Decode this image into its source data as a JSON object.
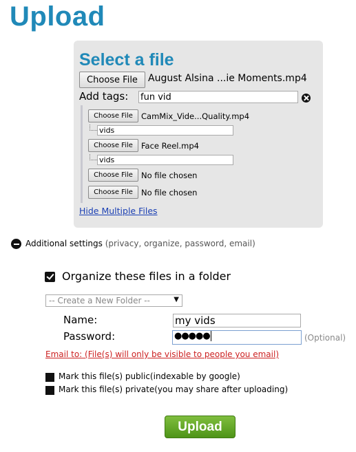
{
  "page": {
    "title": "Upload"
  },
  "select_file": {
    "heading": "Select a file",
    "choose_label": "Choose File",
    "chosen_file": "August Alsina ...ie Moments.mp4",
    "tags_label": "Add tags:",
    "tags_value": "fun vid"
  },
  "multiple_files": {
    "items": [
      {
        "choose_label": "Choose File",
        "file": "CamMix_Vide...Quality.mp4",
        "tags": "vids"
      },
      {
        "choose_label": "Choose File",
        "file": "Face Reel.mp4",
        "tags": "vids"
      },
      {
        "choose_label": "Choose File",
        "file": "No file chosen"
      },
      {
        "choose_label": "Choose File",
        "file": "No file chosen"
      }
    ],
    "hide_link": "Hide Multiple Files"
  },
  "additional": {
    "label": "Additional settings",
    "hint": "(privacy, organize, password, email)"
  },
  "folder": {
    "organize_label": "Organize these files in a folder",
    "organize_checked": true,
    "select_value": "-- Create a New Folder --",
    "name_label": "Name:",
    "name_value": "my vids",
    "password_label": "Password:",
    "password_value": "●●●●●",
    "optional": "(Optional)"
  },
  "email_note": "Email to: (File(s) will only be visible to people you email)",
  "privacy": {
    "public_label": "Mark this file(s) public(indexable by google)",
    "private_label": "Mark this file(s) private(you may share after uploading)"
  },
  "upload_button": "Upload",
  "colors": {
    "accent": "#2089b8",
    "upload_green": "#5ea52a",
    "warning_red": "#cc2222",
    "link_blue": "#1a3fb3"
  }
}
